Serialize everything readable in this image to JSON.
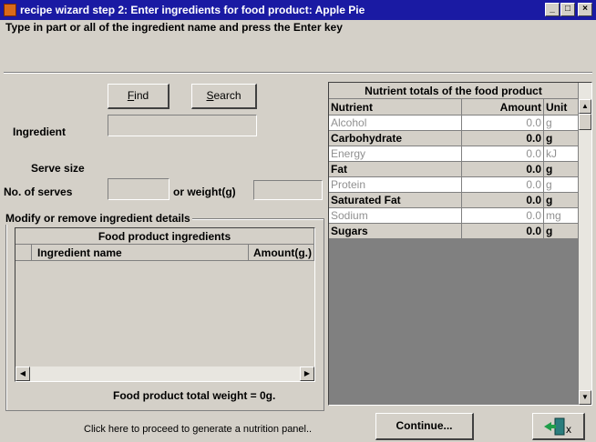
{
  "window": {
    "title": "recipe wizard step 2: Enter ingredients for food product: Apple Pie",
    "controls": {
      "minimize": "_",
      "maximize": "□",
      "close": "×"
    }
  },
  "instruction": "Type in part or all of the ingredient name and press the Enter key",
  "search": {
    "find_label": "Find",
    "find_mnemonic": "F",
    "find_rest": "ind",
    "search_label": "Search",
    "search_mnemonic": "S",
    "search_rest": "earch",
    "ingredient_label": "Ingredient",
    "ingredient_value": "",
    "serve_size_label": "Serve size",
    "no_serves_label": "No. of serves",
    "no_serves_value": "",
    "weight_label": "or weight(g)",
    "weight_value": ""
  },
  "modify": {
    "group_label": "Modify or remove ingredient details",
    "table_title": "Food product ingredients",
    "col_name": "Ingredient name",
    "col_amount": "Amount(g.)",
    "rows": [],
    "total_label": "Food product total weight =  0g."
  },
  "nutrients": {
    "title": "Nutrient totals of the food product",
    "col_nutrient": "Nutrient",
    "col_amount": "Amount",
    "col_unit": "Unit",
    "rows": [
      {
        "name": "Alcohol",
        "amount": "0.0",
        "unit": "g",
        "bold": false
      },
      {
        "name": "Carbohydrate",
        "amount": "0.0",
        "unit": "g",
        "bold": true
      },
      {
        "name": "Energy",
        "amount": "0.0",
        "unit": "kJ",
        "bold": false
      },
      {
        "name": "Fat",
        "amount": "0.0",
        "unit": "g",
        "bold": true
      },
      {
        "name": "Protein",
        "amount": "0.0",
        "unit": "g",
        "bold": false
      },
      {
        "name": "Saturated Fat",
        "amount": "0.0",
        "unit": "g",
        "bold": true
      },
      {
        "name": "Sodium",
        "amount": "0.0",
        "unit": "mg",
        "bold": false
      },
      {
        "name": "Sugars",
        "amount": "0.0",
        "unit": "g",
        "bold": true
      }
    ]
  },
  "footer": {
    "hint": "Click here to proceed to generate a nutrition panel..",
    "continue_label": "Continue...",
    "exit_icon": "exit-door-icon"
  }
}
